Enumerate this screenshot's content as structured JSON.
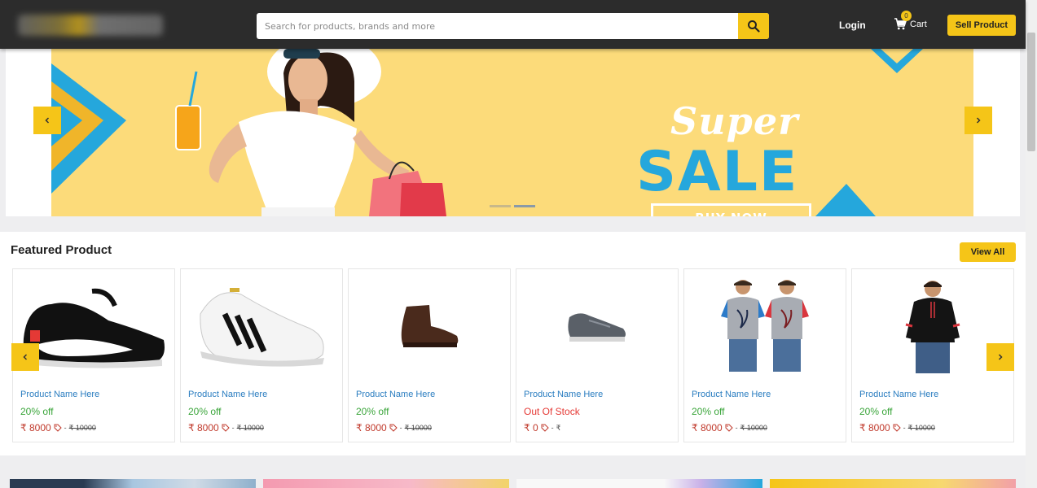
{
  "header": {
    "search_placeholder": "Search for products, brands and more",
    "login_label": "Login",
    "cart_label": "Cart",
    "cart_count": "0",
    "sell_label": "Sell Product"
  },
  "banner": {
    "headline_top": "Super",
    "headline_main": "SALE",
    "cta_label": "BUY NOW",
    "slide_count": 2,
    "active_slide": 2
  },
  "featured": {
    "title": "Featured Product",
    "view_all_label": "View All",
    "products": [
      {
        "name": "Product Name Here",
        "status": "20% off",
        "price": "₹ 8000",
        "old_price": "₹ 10000",
        "image": "sneaker-black-icon"
      },
      {
        "name": "Product Name Here",
        "status": "20% off",
        "price": "₹ 8000",
        "old_price": "₹ 10000",
        "image": "sneaker-white-icon"
      },
      {
        "name": "Product Name Here",
        "status": "20% off",
        "price": "₹ 8000",
        "old_price": "₹ 10000",
        "image": "boot-brown-icon"
      },
      {
        "name": "Product Name Here",
        "status": "Out Of Stock",
        "price": "₹ 0",
        "old_price": "₹",
        "image": "sneaker-grey-icon"
      },
      {
        "name": "Product Name Here",
        "status": "20% off",
        "price": "₹ 8000",
        "old_price": "₹ 10000",
        "image": "tshirt-models-icon"
      },
      {
        "name": "Product Name Here",
        "status": "20% off",
        "price": "₹ 8000",
        "old_price": "₹ 10000",
        "image": "hoodie-model-icon"
      }
    ]
  },
  "colors": {
    "accent": "#f5c518",
    "header_bg": "#2c2c2c",
    "banner_bg": "#fcdb7a",
    "sale_blue": "#25a7dc",
    "link_blue": "#2a7dc0",
    "discount_green": "#3aa53a",
    "out_of_stock_red": "#e53935",
    "price_red": "#c0392b"
  }
}
